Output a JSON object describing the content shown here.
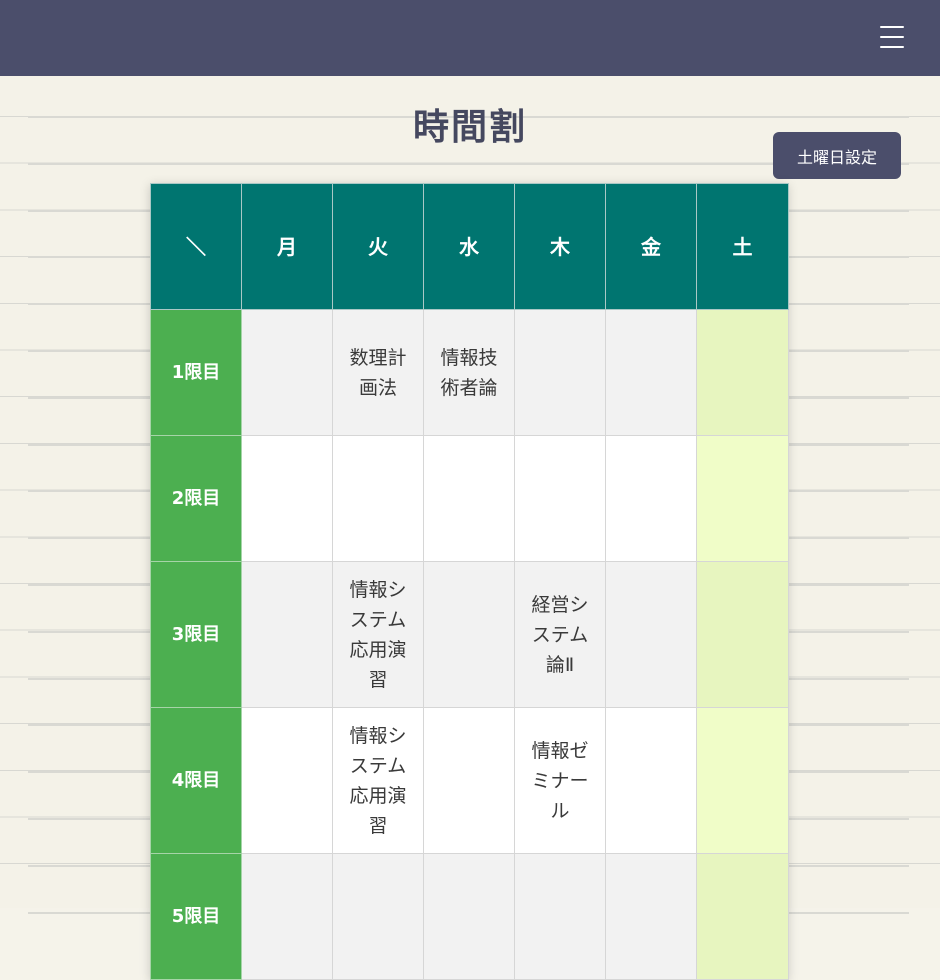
{
  "header": {
    "menu_icon": "hamburger-menu-icon"
  },
  "page": {
    "title": "時間割"
  },
  "saturday_button": {
    "label": "土曜日設定"
  },
  "timetable": {
    "corner": "＼",
    "days": [
      "月",
      "火",
      "水",
      "木",
      "金",
      "土"
    ],
    "periods": [
      {
        "label": "1限目",
        "cells": [
          "",
          "数理計画法",
          "情報技術者論",
          "",
          "",
          ""
        ]
      },
      {
        "label": "2限目",
        "cells": [
          "",
          "",
          "",
          "",
          "",
          ""
        ]
      },
      {
        "label": "3限目",
        "cells": [
          "",
          "情報システム応用演習",
          "",
          "経営システム論Ⅱ",
          "",
          ""
        ]
      },
      {
        "label": "4限目",
        "cells": [
          "",
          "情報システム応用演習",
          "",
          "情報ゼミナール",
          "",
          ""
        ]
      },
      {
        "label": "5限目",
        "cells": [
          "",
          "",
          "",
          "",
          "",
          ""
        ]
      }
    ]
  },
  "colors": {
    "header_bar": "#4b4e6b",
    "day_header": "#007570",
    "period_header": "#4caf50",
    "saturday_col_odd": "#e7f5bf",
    "saturday_col_even": "#f0fdc8"
  }
}
